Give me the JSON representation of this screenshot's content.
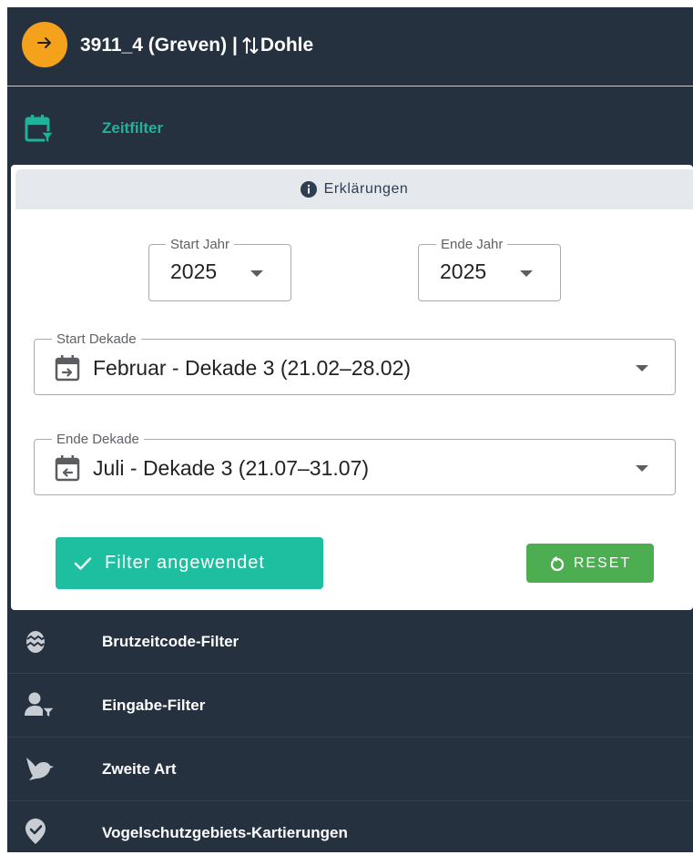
{
  "header": {
    "title_prefix": "3911_4 (Greven) |",
    "title_suffix": "Dohle",
    "nav_icon": "arrow-right-icon",
    "swap_icon": "swap-vertical-icon",
    "accent": "#f4a11c"
  },
  "zeitfilter": {
    "label": "Zeitfilter",
    "icon": "calendar-filter-icon",
    "color": "#1fb39a"
  },
  "card": {
    "explain": {
      "label": "Erklärungen",
      "icon": "info-icon"
    },
    "start_jahr": {
      "legend": "Start Jahr",
      "value": "2025"
    },
    "ende_jahr": {
      "legend": "Ende Jahr",
      "value": "2025"
    },
    "start_dekade": {
      "legend": "Start Dekade",
      "value": "Februar - Dekade 3 (21.02–28.02)",
      "icon": "calendar-arrow-right-icon"
    },
    "ende_dekade": {
      "legend": "Ende Dekade",
      "value": "Juli - Dekade 3 (21.07–31.07)",
      "icon": "calendar-arrow-left-icon"
    },
    "apply_button": {
      "label": "Filter angewendet",
      "icon": "check-icon",
      "color": "#1dbfa0"
    },
    "reset_button": {
      "label": "RESET",
      "icon": "restore-icon",
      "color": "#4cae50"
    }
  },
  "menu": [
    {
      "label": "Brutzeitcode-Filter",
      "icon": "egg-icon"
    },
    {
      "label": "Eingabe-Filter",
      "icon": "person-filter-icon"
    },
    {
      "label": "Zweite Art",
      "icon": "bird-icon"
    },
    {
      "label": "Vogelschutzgebiets-Kartierungen",
      "icon": "shield-check-icon"
    }
  ]
}
